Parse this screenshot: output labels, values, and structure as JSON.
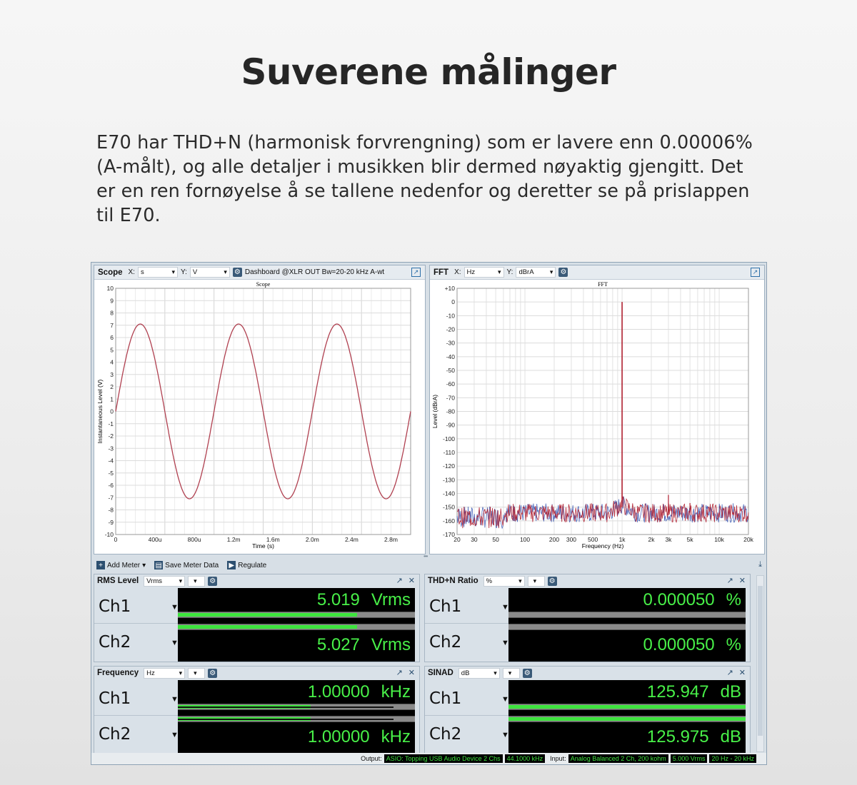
{
  "page": {
    "title": "Suverene målinger",
    "body": "E70 har THD+N (harmonisk forvrengning) som er lavere enn 0.00006% (A-målt), og alle detaljer i musikken blir dermed nøyaktig gjengitt. Det er en ren fornøyelse å se tallene nedenfor og deretter se på prislappen til E70."
  },
  "scope_panel": {
    "title": "Scope",
    "x_label": "X:",
    "x_unit": "s",
    "y_label": "Y:",
    "y_unit": "V",
    "info": "Dashboard  @XLR OUT  Bw=20-20 kHz A-wt"
  },
  "fft_panel": {
    "title": "FFT",
    "x_label": "X:",
    "x_unit": "Hz",
    "y_label": "Y:",
    "y_unit": "dBrA"
  },
  "chart_data": [
    {
      "type": "line",
      "title": "Scope",
      "xlabel": "Time (s)",
      "ylabel": "Instantaneous Level (V)",
      "xlim": [
        0,
        0.003
      ],
      "ylim": [
        -10,
        10
      ],
      "x_ticks": [
        0,
        0.0004,
        0.0008,
        0.0012,
        0.0016,
        0.002,
        0.0024,
        0.0028
      ],
      "x_tick_labels": [
        "0",
        "400u",
        "800u",
        "1.2m",
        "1.6m",
        "2.0m",
        "2.4m",
        "2.8m"
      ],
      "y_ticks": [
        10,
        9,
        8,
        7,
        6,
        5,
        4,
        3,
        2,
        1,
        0,
        -1,
        -2,
        -3,
        -4,
        -5,
        -6,
        -7,
        -8,
        -9,
        -10
      ],
      "series": [
        {
          "signal": "sine",
          "amplitude": 7.1,
          "frequency_hz": 1000,
          "color": "#b04050"
        }
      ],
      "grid": true
    },
    {
      "type": "line",
      "title": "FFT",
      "xlabel": "Frequency (Hz)",
      "ylabel": "Level (dBrA)",
      "x_scale": "log",
      "xlim": [
        20,
        20000
      ],
      "ylim": [
        -170,
        10
      ],
      "x_ticks": [
        20,
        30,
        50,
        100,
        200,
        300,
        500,
        1000,
        2000,
        3000,
        5000,
        10000,
        20000
      ],
      "x_tick_labels": [
        "20",
        "30",
        "50",
        "100",
        "200",
        "300",
        "500",
        "1k",
        "2k",
        "3k",
        "5k",
        "10k",
        "20k"
      ],
      "y_ticks": [
        10,
        0,
        -10,
        -20,
        -30,
        -40,
        -50,
        -60,
        -70,
        -80,
        -90,
        -100,
        -110,
        -120,
        -130,
        -140,
        -150,
        -160,
        -170
      ],
      "y_tick_labels": [
        "+10",
        "0",
        "-10",
        "-20",
        "-30",
        "-40",
        "-50",
        "-60",
        "-70",
        "-80",
        "-90",
        "-100",
        "-110",
        "-120",
        "-130",
        "-140",
        "-150",
        "-160",
        "-170"
      ],
      "fundamental": {
        "x": 1000,
        "y": 0
      },
      "harmonic_spikes": [
        {
          "x": 3000,
          "y": -141
        },
        {
          "x": 5000,
          "y": -147
        }
      ],
      "noise_floor_db": -157,
      "series": [
        {
          "color": "#3050b0"
        },
        {
          "color": "#b02030"
        }
      ],
      "grid": true
    }
  ],
  "meter_toolbar": {
    "add_meter": "Add Meter",
    "save_meter_data": "Save Meter Data",
    "regulate": "Regulate"
  },
  "meters": {
    "rms": {
      "title": "RMS Level",
      "unit_select": "Vrms",
      "ch1": {
        "label": "Ch1",
        "value": "5.019",
        "unit": "Vrms",
        "level": 0.755
      },
      "ch2": {
        "label": "Ch2",
        "value": "5.027",
        "unit": "Vrms",
        "level": 0.755
      }
    },
    "thdn": {
      "title": "THD+N Ratio",
      "unit_select": "%",
      "ch1": {
        "label": "Ch1",
        "value": "0.000050",
        "unit": "%",
        "level": 0.0
      },
      "ch2": {
        "label": "Ch2",
        "value": "0.000050",
        "unit": "%",
        "level": 0.0
      }
    },
    "freq": {
      "title": "Frequency",
      "unit_select": "Hz",
      "ch1": {
        "label": "Ch1",
        "value": "1.00000",
        "unit": "kHz",
        "level": 0.56
      },
      "ch2": {
        "label": "Ch2",
        "value": "1.00000",
        "unit": "kHz",
        "level": 0.56
      }
    },
    "sinad": {
      "title": "SINAD",
      "unit_select": "dB",
      "ch1": {
        "label": "Ch1",
        "value": "125.947",
        "unit": "dB",
        "level": 1.0
      },
      "ch2": {
        "label": "Ch2",
        "value": "125.975",
        "unit": "dB",
        "level": 1.0
      }
    }
  },
  "status_bar": {
    "output_label": "Output:",
    "output_device": "ASIO: Topping USB Audio Device 2 Chs",
    "output_rate": "44.1000 kHz",
    "input_label": "Input:",
    "input_device": "Analog Balanced 2 Ch, 200 kohm",
    "input_level": "5.000 Vrms",
    "input_bw": "20 Hz - 20 kHz"
  },
  "colors": {
    "meter_text": "#48f048",
    "bar_fill": "#3de43d",
    "panel_bg": "#d7dfe6"
  }
}
